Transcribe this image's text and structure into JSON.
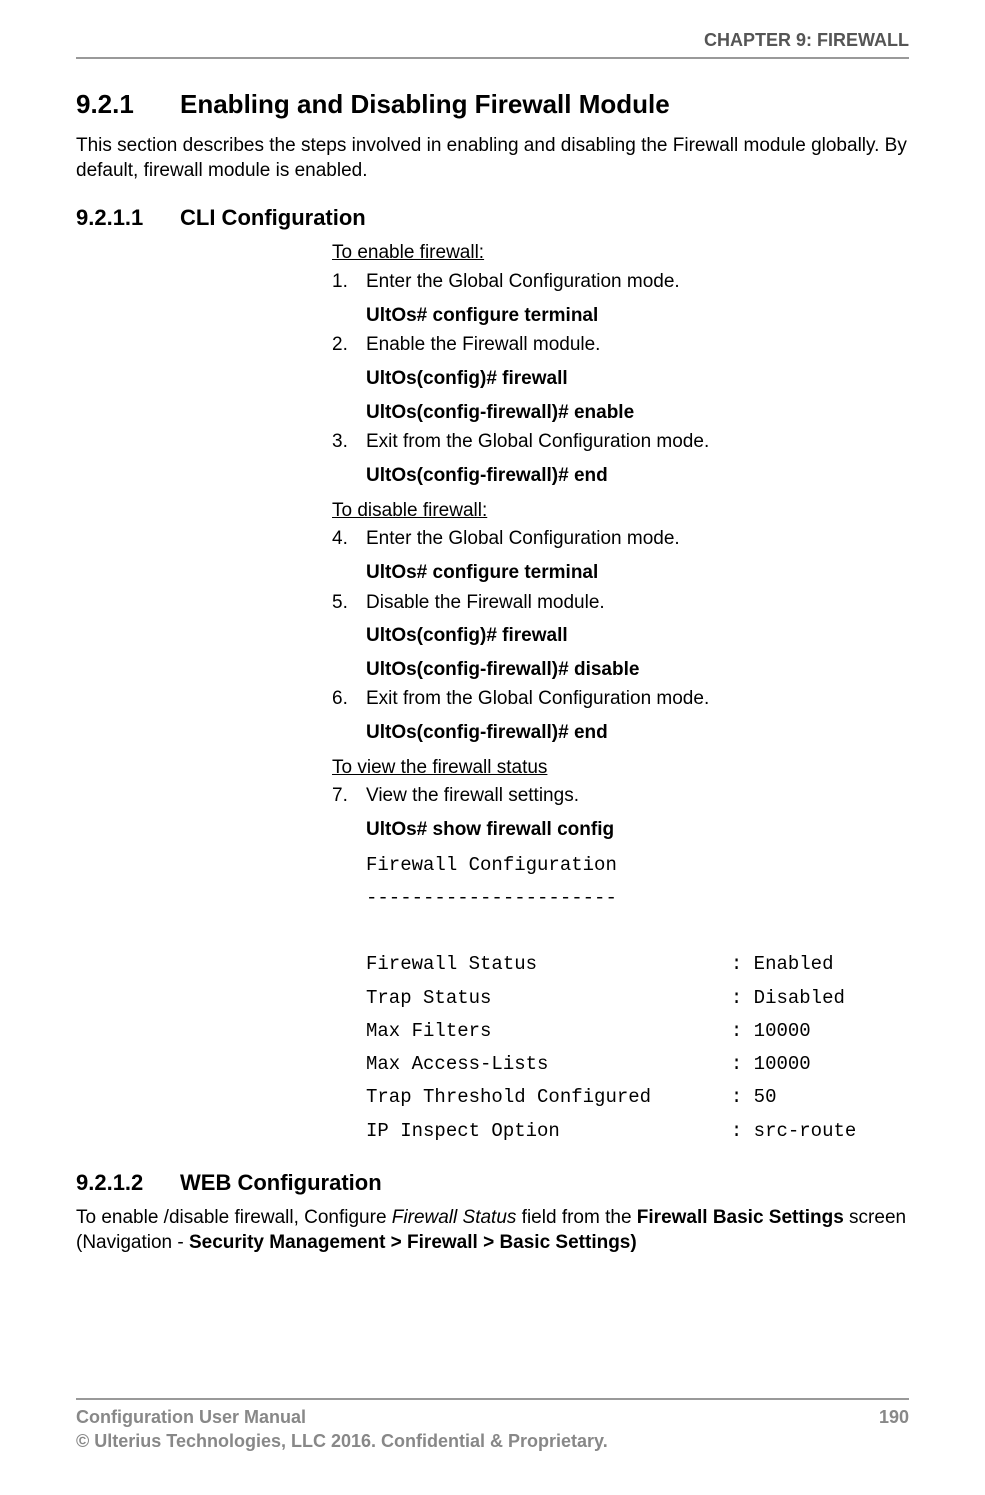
{
  "header": {
    "chapter": "CHAPTER 9: FIREWALL"
  },
  "section_921": {
    "num": "9.2.1",
    "title": "Enabling and Disabling Firewall Module",
    "intro": "This section describes the steps involved in enabling and disabling the Firewall module globally. By default, firewall module is enabled."
  },
  "section_9211": {
    "num": "9.2.1.1",
    "title": "CLI Configuration",
    "enable_label": "To enable firewall:",
    "steps_enable": [
      {
        "n": "1.",
        "t": "Enter the Global Configuration mode.",
        "cmds": [
          "UltOs# configure terminal"
        ]
      },
      {
        "n": "2.",
        "t": "Enable the Firewall module.",
        "cmds": [
          "UltOs(config)# firewall",
          "UltOs(config-firewall)# enable"
        ]
      },
      {
        "n": "3.",
        "t": "Exit from the Global Configuration mode.",
        "cmds": [
          "UltOs(config-firewall)# end"
        ]
      }
    ],
    "disable_label": "To disable firewall:",
    "steps_disable": [
      {
        "n": "4.",
        "t": "Enter the Global Configuration mode.",
        "cmds": [
          "UltOs# configure terminal"
        ]
      },
      {
        "n": "5.",
        "t": "Disable the Firewall module.",
        "cmds": [
          "UltOs(config)# firewall",
          "UltOs(config-firewall)# disable"
        ]
      },
      {
        "n": "6.",
        "t": "Exit from the Global Configuration mode.",
        "cmds": [
          "UltOs(config-firewall)# end"
        ]
      }
    ],
    "view_label": "To view the firewall status",
    "steps_view": [
      {
        "n": "7.",
        "t": "View the firewall settings.",
        "cmds": [
          "UltOs# show firewall config"
        ]
      }
    ],
    "output": "Firewall Configuration\n----------------------\n\nFirewall Status                 : Enabled\nTrap Status                     : Disabled\nMax Filters                     : 10000\nMax Access-Lists                : 10000\nTrap Threshold Configured       : 50\nIP Inspect Option               : src-route"
  },
  "section_9212": {
    "num": "9.2.1.2",
    "title": "WEB Configuration",
    "para_pre": "To enable /disable firewall, Configure ",
    "para_italic": "Firewall Status",
    "para_mid": " field from the ",
    "para_b1": "Firewall Basic Settings",
    "para_mid2": " screen (Navigation - ",
    "para_b2": "Security Management > Firewall > Basic Settings)"
  },
  "footer": {
    "line1": "Configuration User Manual",
    "line2": "© Ulterius Technologies, LLC 2016. Confidential & Proprietary.",
    "page": "190"
  }
}
